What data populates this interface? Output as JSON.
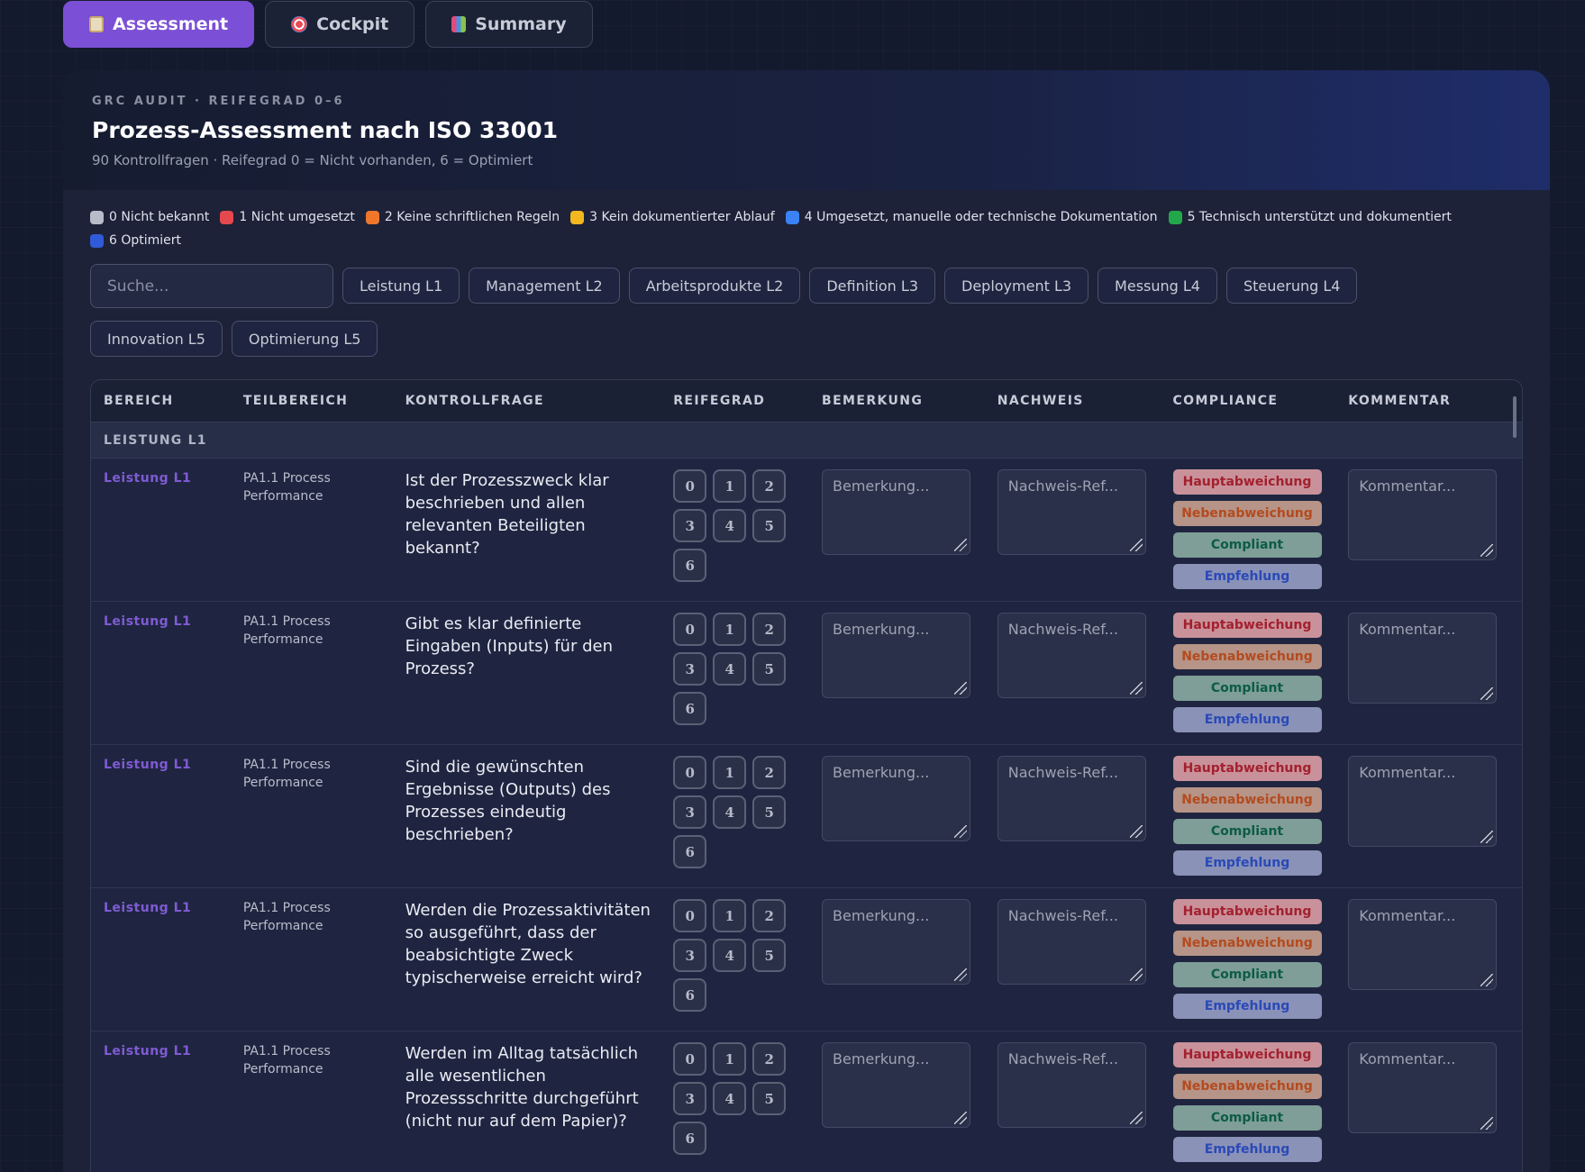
{
  "tabs": [
    {
      "label": "Assessment",
      "icon": "clipboard-icon",
      "active": true
    },
    {
      "label": "Cockpit",
      "icon": "target-icon",
      "active": false
    },
    {
      "label": "Summary",
      "icon": "bar-chart-icon",
      "active": false
    }
  ],
  "header": {
    "eyebrow": "GRC AUDIT · REIFEGRAD 0–6",
    "title": "Prozess-Assessment nach ISO 33001",
    "subtitle": "90 Kontrollfragen · Reifegrad 0 = Nicht vorhanden, 6 = Optimiert"
  },
  "legend": [
    {
      "label": "0 Nicht bekannt",
      "color": "#b8bcc8"
    },
    {
      "label": "1 Nicht umgesetzt",
      "color": "#e5484d"
    },
    {
      "label": "2 Keine schriftlichen Regeln",
      "color": "#f0762b"
    },
    {
      "label": "3 Kein dokumentierter Ablauf",
      "color": "#f2b81e"
    },
    {
      "label": "4 Umgesetzt, manuelle oder technische Dokumentation",
      "color": "#3b82f6"
    },
    {
      "label": "5 Technisch unterstützt und dokumentiert",
      "color": "#22a84a"
    },
    {
      "label": "6 Optimiert",
      "color": "#2f5bd8"
    }
  ],
  "search": {
    "placeholder": "Suche..."
  },
  "filters": [
    "Leistung L1",
    "Management L2",
    "Arbeitsprodukte L2",
    "Definition L3",
    "Deployment L3",
    "Messung L4",
    "Steuerung L4",
    "Innovation L5",
    "Optimierung L5"
  ],
  "table": {
    "columns": [
      "BEREICH",
      "TEILBEREICH",
      "KONTROLLFRAGE",
      "REIFEGRAD",
      "BEMERKUNG",
      "NACHWEIS",
      "COMPLIANCE",
      "KOMMENTAR"
    ],
    "section": "LEISTUNG L1",
    "grades": [
      "0",
      "1",
      "2",
      "3",
      "4",
      "5",
      "6"
    ],
    "placeholders": {
      "bemerkung": "Bemerkung...",
      "nachweis": "Nachweis-Ref...",
      "kommentar": "Kommentar..."
    },
    "compliance": [
      "Hauptabweichung",
      "Nebenabweichung",
      "Compliant",
      "Empfehlung"
    ],
    "rows": [
      {
        "bereich": "Leistung L1",
        "teilbereich": "PA1.1 Process Performance",
        "frage": "Ist der Prozesszweck klar beschrieben und allen relevanten Beteiligten bekannt?"
      },
      {
        "bereich": "Leistung L1",
        "teilbereich": "PA1.1 Process Performance",
        "frage": "Gibt es klar definierte Eingaben (Inputs) für den Prozess?"
      },
      {
        "bereich": "Leistung L1",
        "teilbereich": "PA1.1 Process Performance",
        "frage": "Sind die gewünschten Ergebnisse (Outputs) des Prozesses eindeutig beschrieben?"
      },
      {
        "bereich": "Leistung L1",
        "teilbereich": "PA1.1 Process Performance",
        "frage": "Werden die Prozessaktivitäten so ausgeführt, dass der beabsichtigte Zweck typischerweise erreicht wird?"
      },
      {
        "bereich": "Leistung L1",
        "teilbereich": "PA1.1 Process Performance",
        "frage": "Werden im Alltag tatsächlich alle wesentlichen Prozessschritte durchgeführt (nicht nur auf dem Papier)?"
      }
    ]
  }
}
